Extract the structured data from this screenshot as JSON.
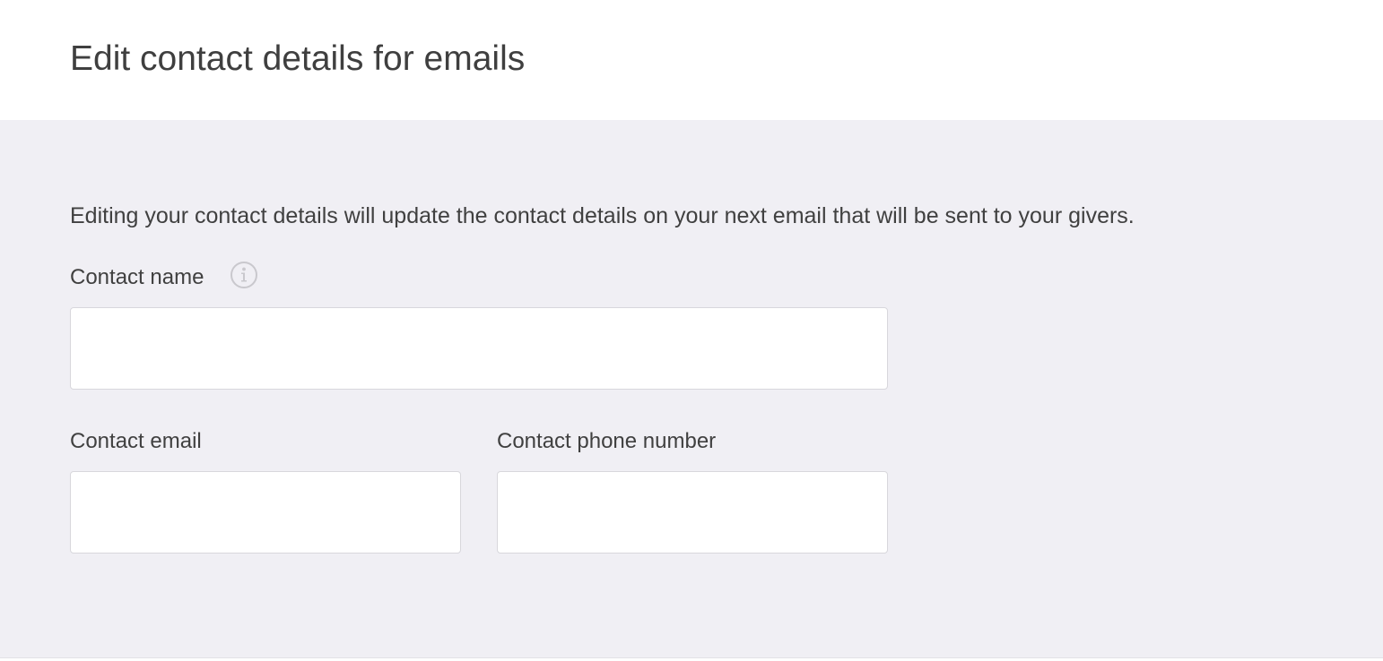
{
  "header": {
    "title": "Edit contact details for emails"
  },
  "form": {
    "description": "Editing your contact details will update the contact details on your next email that will be sent to your givers.",
    "contact_name": {
      "label": "Contact name",
      "value": "",
      "info_icon": "info-icon"
    },
    "contact_email": {
      "label": "Contact email",
      "value": ""
    },
    "contact_phone": {
      "label": "Contact phone number",
      "value": ""
    }
  },
  "colors": {
    "panel_background": "#f0eff4",
    "text": "#404040",
    "input_border": "#d8d7dc",
    "icon_stroke": "#c9c8cd"
  }
}
